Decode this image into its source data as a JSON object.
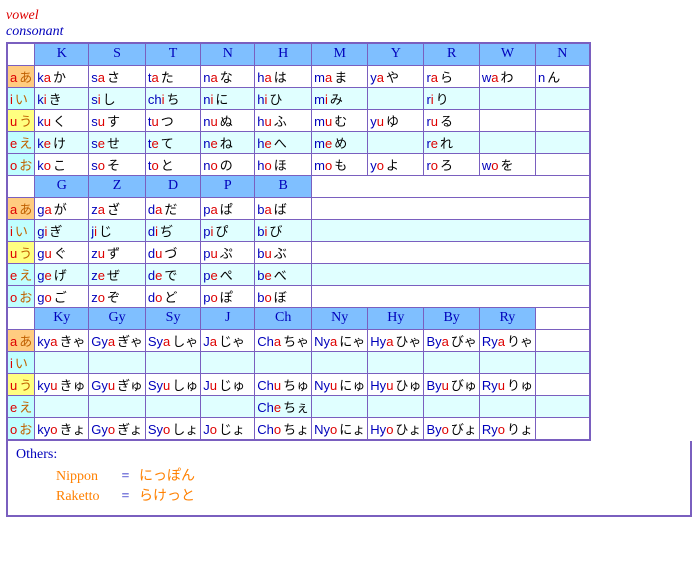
{
  "labels": {
    "vowel": "vowel",
    "consonant": "consonant"
  },
  "vowels": [
    {
      "v": "a",
      "hi": "あ"
    },
    {
      "v": "i",
      "hi": "い"
    },
    {
      "v": "u",
      "hi": "う"
    },
    {
      "v": "e",
      "hi": "え"
    },
    {
      "v": "o",
      "hi": "お"
    }
  ],
  "section1": {
    "headers": [
      "K",
      "S",
      "T",
      "N",
      "H",
      "M",
      "Y",
      "R",
      "W",
      "N"
    ],
    "widths": [
      54,
      54,
      54,
      54,
      54,
      54,
      54,
      54,
      54,
      54
    ],
    "rows": [
      [
        [
          "k",
          "a",
          "か"
        ],
        [
          "s",
          "a",
          "さ"
        ],
        [
          "t",
          "a",
          "た"
        ],
        [
          "n",
          "a",
          "な"
        ],
        [
          "h",
          "a",
          "は"
        ],
        [
          "m",
          "a",
          "ま"
        ],
        [
          "y",
          "a",
          "や"
        ],
        [
          "r",
          "a",
          "ら"
        ],
        [
          "w",
          "a",
          "わ"
        ],
        [
          "n",
          "",
          "ん"
        ]
      ],
      [
        [
          "k",
          "i",
          "き"
        ],
        [
          "s",
          "i",
          "し"
        ],
        [
          "ch",
          "i",
          "ち"
        ],
        [
          "n",
          "i",
          "に"
        ],
        [
          "h",
          "i",
          "ひ"
        ],
        [
          "m",
          "i",
          "み"
        ],
        null,
        [
          "r",
          "i",
          "り"
        ],
        null,
        null
      ],
      [
        [
          "k",
          "u",
          "く"
        ],
        [
          "s",
          "u",
          "す"
        ],
        [
          "t",
          "u",
          "つ"
        ],
        [
          "n",
          "u",
          "ぬ"
        ],
        [
          "h",
          "u",
          "ふ"
        ],
        [
          "m",
          "u",
          "む"
        ],
        [
          "y",
          "u",
          "ゆ"
        ],
        [
          "r",
          "u",
          "る"
        ],
        null,
        null
      ],
      [
        [
          "k",
          "e",
          "け"
        ],
        [
          "s",
          "e",
          "せ"
        ],
        [
          "t",
          "e",
          "て"
        ],
        [
          "n",
          "e",
          "ね"
        ],
        [
          "h",
          "e",
          "へ"
        ],
        [
          "m",
          "e",
          "め"
        ],
        null,
        [
          "r",
          "e",
          "れ"
        ],
        null,
        null
      ],
      [
        [
          "k",
          "o",
          "こ"
        ],
        [
          "s",
          "o",
          "そ"
        ],
        [
          "t",
          "o",
          "と"
        ],
        [
          "n",
          "o",
          "の"
        ],
        [
          "h",
          "o",
          "ほ"
        ],
        [
          "m",
          "o",
          "も"
        ],
        [
          "y",
          "o",
          "よ"
        ],
        [
          "r",
          "o",
          "ろ"
        ],
        [
          "w",
          "o",
          "を"
        ],
        null
      ]
    ]
  },
  "section2": {
    "headers": [
      "G",
      "Z",
      "D",
      "P",
      "B"
    ],
    "rows": [
      [
        [
          "g",
          "a",
          "が"
        ],
        [
          "z",
          "a",
          "ざ"
        ],
        [
          "d",
          "a",
          "だ"
        ],
        [
          "p",
          "a",
          "ぱ"
        ],
        [
          "b",
          "a",
          "ば"
        ]
      ],
      [
        [
          "g",
          "i",
          "ぎ"
        ],
        [
          "j",
          "i",
          "じ"
        ],
        [
          "d",
          "i",
          "ぢ"
        ],
        [
          "p",
          "i",
          "ぴ"
        ],
        [
          "b",
          "i",
          "び"
        ]
      ],
      [
        [
          "g",
          "u",
          "ぐ"
        ],
        [
          "z",
          "u",
          "ず"
        ],
        [
          "d",
          "u",
          "づ"
        ],
        [
          "p",
          "u",
          "ぷ"
        ],
        [
          "b",
          "u",
          "ぶ"
        ]
      ],
      [
        [
          "g",
          "e",
          "げ"
        ],
        [
          "z",
          "e",
          "ぜ"
        ],
        [
          "d",
          "e",
          "で"
        ],
        [
          "p",
          "e",
          "ぺ"
        ],
        [
          "b",
          "e",
          "べ"
        ]
      ],
      [
        [
          "g",
          "o",
          "ご"
        ],
        [
          "z",
          "o",
          "ぞ"
        ],
        [
          "d",
          "o",
          "ど"
        ],
        [
          "p",
          "o",
          "ぽ"
        ],
        [
          "b",
          "o",
          "ぼ"
        ]
      ]
    ]
  },
  "section3": {
    "headers": [
      "Ky",
      "Gy",
      "Sy",
      "J",
      "Ch",
      "Ny",
      "Hy",
      "By",
      "Ry"
    ],
    "rows": [
      [
        [
          "ky",
          "a",
          "きゃ"
        ],
        [
          "Gy",
          "a",
          "ぎゃ"
        ],
        [
          "Sy",
          "a",
          "しゃ"
        ],
        [
          "J",
          "a",
          "じゃ"
        ],
        [
          "Ch",
          "a",
          "ちゃ"
        ],
        [
          "Ny",
          "a",
          "にゃ"
        ],
        [
          "Hy",
          "a",
          "ひゃ"
        ],
        [
          "By",
          "a",
          "びゃ"
        ],
        [
          "Ry",
          "a",
          "りゃ"
        ]
      ],
      [
        null,
        null,
        null,
        null,
        null,
        null,
        null,
        null,
        null
      ],
      [
        [
          "ky",
          "u",
          "きゅ"
        ],
        [
          "Gy",
          "u",
          "ぎゅ"
        ],
        [
          "Sy",
          "u",
          "しゅ"
        ],
        [
          "J",
          "u",
          "じゅ"
        ],
        [
          "Ch",
          "u",
          "ちゅ"
        ],
        [
          "Ny",
          "u",
          "にゅ"
        ],
        [
          "Hy",
          "u",
          "ひゅ"
        ],
        [
          "By",
          "u",
          "びゅ"
        ],
        [
          "Ry",
          "u",
          "りゅ"
        ]
      ],
      [
        null,
        null,
        null,
        null,
        [
          "Ch",
          "e",
          "ちぇ"
        ],
        null,
        null,
        null,
        null
      ],
      [
        [
          "ky",
          "o",
          "きょ"
        ],
        [
          "Gy",
          "o",
          "ぎょ"
        ],
        [
          "Sy",
          "o",
          "しょ"
        ],
        [
          "J",
          "o",
          "じょ"
        ],
        [
          "Ch",
          "o",
          "ちょ"
        ],
        [
          "Ny",
          "o",
          "にょ"
        ],
        [
          "Hy",
          "o",
          "ひょ"
        ],
        [
          "By",
          "o",
          "びょ"
        ],
        [
          "Ry",
          "o",
          "りょ"
        ]
      ]
    ]
  },
  "others": {
    "heading": "Others:",
    "eq": "=",
    "rows": [
      {
        "romaji": "Nippon",
        "kana": "にっぽん"
      },
      {
        "romaji": "Raketto",
        "kana": "らけっと"
      }
    ]
  }
}
